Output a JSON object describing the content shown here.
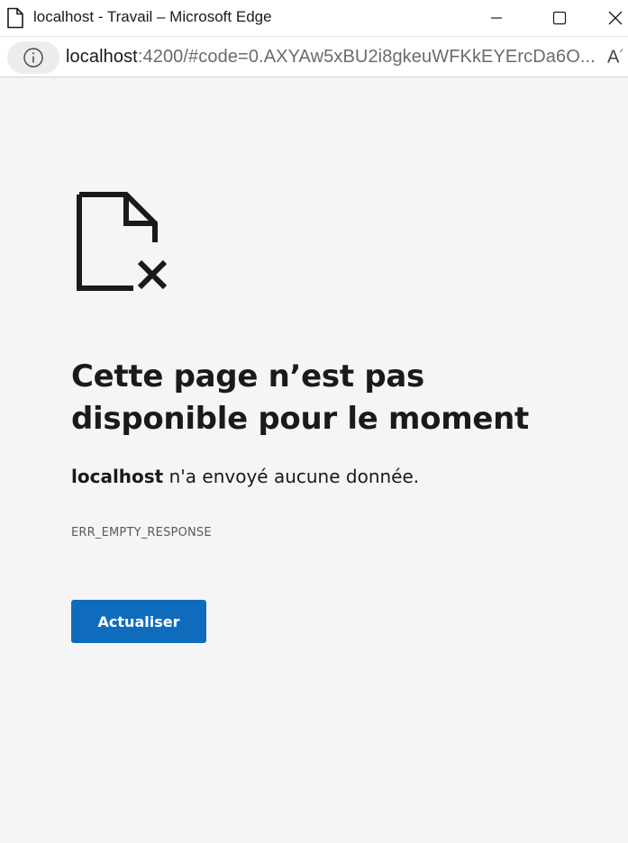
{
  "window": {
    "title": "localhost - Travail – Microsoft Edge",
    "page_icon": "page-icon",
    "controls": {
      "minimize_icon": "minimize-icon",
      "maximize_icon": "maximize-icon",
      "close_icon": "close-icon"
    }
  },
  "address_bar": {
    "site_info_icon": "info-icon",
    "url_host": "localhost",
    "url_rest": ":4200/#code=0.AXYAw5xBU2i8gkeuWFKkEYErcDa6O...",
    "read_aloud_glyph": "Aͅ",
    "read_aloud_icon": "read-aloud-icon"
  },
  "error_page": {
    "icon": "broken-page-icon",
    "heading": "Cette page n’est pas disponible pour le moment",
    "host": "localhost",
    "message": " n'a envoyé aucune donnée.",
    "error_code": "ERR_EMPTY_RESPONSE",
    "reload_label": "Actualiser",
    "accent_color": "#0f6cbd",
    "background_color": "#f5f5f5"
  }
}
